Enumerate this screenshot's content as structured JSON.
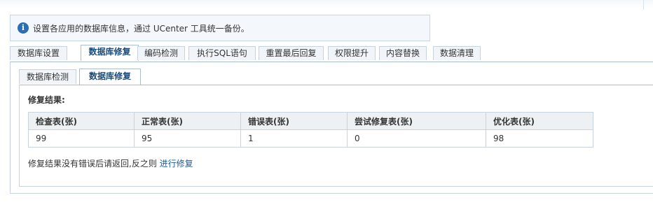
{
  "notice": {
    "icon": "info-icon",
    "text": "设置各应用的数据库信息，通过 UCenter 工具统一备份。"
  },
  "tabs": [
    {
      "label": "数据库设置",
      "active": false
    },
    {
      "label": "数据库修复",
      "active": true
    },
    {
      "label": "编码检测",
      "active": false
    },
    {
      "label": "执行SQL语句",
      "active": false
    },
    {
      "label": "重置最后回复",
      "active": false
    },
    {
      "label": "权限提升",
      "active": false
    },
    {
      "label": "内容替换",
      "active": false
    },
    {
      "label": "数据清理",
      "active": false
    }
  ],
  "subtabs": [
    {
      "label": "数据库检测",
      "active": false
    },
    {
      "label": "数据库修复",
      "active": true
    }
  ],
  "section_title": "修复结果:",
  "table": {
    "headers": [
      "检查表(张)",
      "正常表(张)",
      "错误表(张)",
      "尝试修复表(张)",
      "优化表(张)"
    ],
    "rows": [
      [
        "99",
        "95",
        "1",
        "0",
        "98"
      ]
    ]
  },
  "footer": {
    "text": "修复结果没有错误后请返回,反之则",
    "link": "进行修复"
  }
}
